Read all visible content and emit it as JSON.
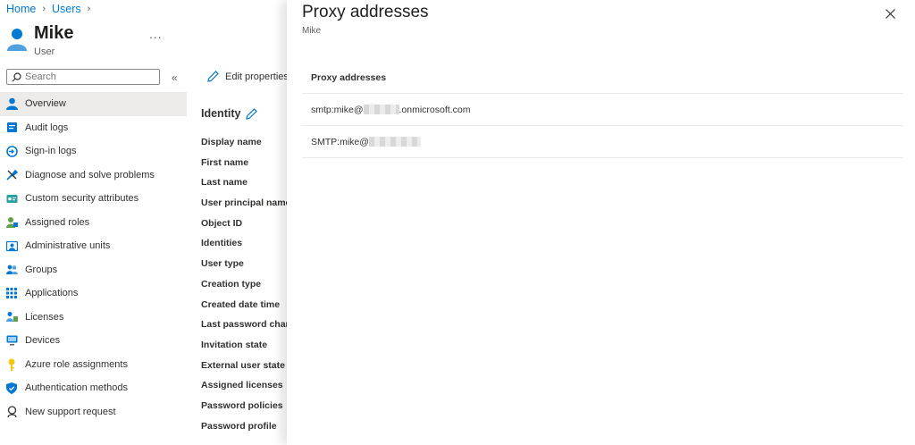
{
  "breadcrumb": {
    "home": "Home",
    "users": "Users"
  },
  "header": {
    "name": "Mike",
    "subtitle": "User",
    "more": "..."
  },
  "search": {
    "placeholder": "Search"
  },
  "nav": {
    "items": [
      {
        "label": "Overview",
        "icon": "user-icon"
      },
      {
        "label": "Audit logs",
        "icon": "audit-log-icon"
      },
      {
        "label": "Sign-in logs",
        "icon": "sign-in-icon"
      },
      {
        "label": "Diagnose and solve problems",
        "icon": "wrench-icon"
      },
      {
        "label": "Custom security attributes",
        "icon": "attributes-icon"
      },
      {
        "label": "Assigned roles",
        "icon": "roles-icon"
      },
      {
        "label": "Administrative units",
        "icon": "admin-units-icon"
      },
      {
        "label": "Groups",
        "icon": "groups-icon"
      },
      {
        "label": "Applications",
        "icon": "grid-icon"
      },
      {
        "label": "Licenses",
        "icon": "license-icon"
      },
      {
        "label": "Devices",
        "icon": "device-icon"
      },
      {
        "label": "Azure role assignments",
        "icon": "key-icon"
      },
      {
        "label": "Authentication methods",
        "icon": "shield-icon"
      },
      {
        "label": "New support request",
        "icon": "support-icon"
      }
    ]
  },
  "toolbar": {
    "edit_properties": "Edit properties"
  },
  "identity": {
    "title": "Identity",
    "fields": [
      "Display name",
      "First name",
      "Last name",
      "User principal name",
      "Object ID",
      "Identities",
      "User type",
      "Creation type",
      "Created date time",
      "Last password change",
      "Invitation state",
      "External user state change",
      "Assigned licenses",
      "Password policies",
      "Password profile"
    ]
  },
  "panel": {
    "title": "Proxy addresses",
    "subtitle": "Mike",
    "column_header": "Proxy addresses",
    "rows": [
      {
        "prefix": "smtp:mike@",
        "suffix": ".onmicrosoft.com"
      },
      {
        "prefix": "SMTP:mike@",
        "suffix": ""
      }
    ]
  },
  "colors": {
    "accent": "#0078d4",
    "nav_active": "#edebe9"
  }
}
